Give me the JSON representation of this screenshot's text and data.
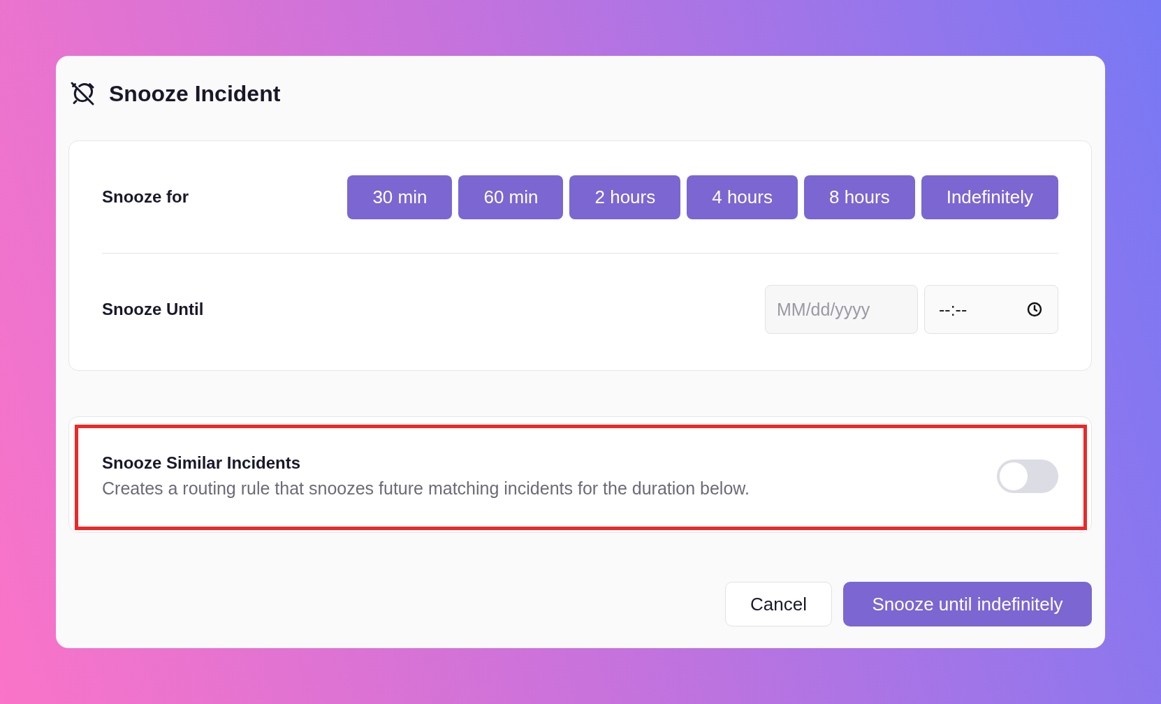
{
  "dialog": {
    "title": "Snooze Incident"
  },
  "snooze_for": {
    "label": "Snooze for",
    "options": [
      {
        "label": "30 min"
      },
      {
        "label": "60 min"
      },
      {
        "label": "2 hours"
      },
      {
        "label": "4 hours"
      },
      {
        "label": "8 hours"
      },
      {
        "label": "Indefinitely"
      }
    ]
  },
  "snooze_until": {
    "label": "Snooze Until",
    "date": {
      "placeholder": "MM/dd/yyyy"
    },
    "time": {
      "placeholder": "--:--"
    }
  },
  "similar": {
    "title": "Snooze Similar Incidents",
    "description": "Creates a routing rule that snoozes future matching incidents for the duration below.",
    "on": false,
    "highlighted": true
  },
  "buttons": [
    {
      "kind": "secondary",
      "label": "Cancel"
    },
    {
      "kind": "primary",
      "label": "Snooze until indefinitely"
    }
  ]
}
